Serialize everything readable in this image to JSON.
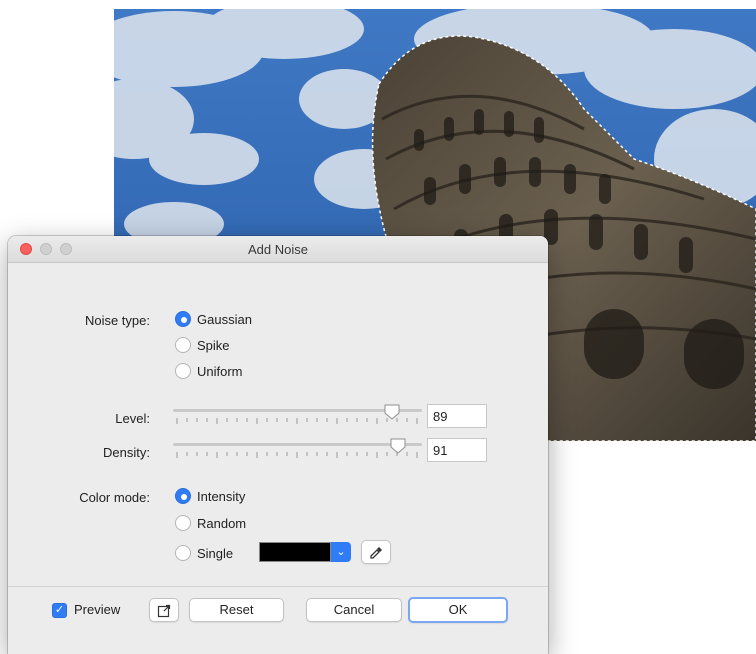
{
  "dialog": {
    "title": "Add Noise",
    "noise_type_label": "Noise type:",
    "noise_types": [
      "Gaussian",
      "Spike",
      "Uniform"
    ],
    "noise_type_selected": "Gaussian",
    "level_label": "Level:",
    "level_value": "89",
    "density_label": "Density:",
    "density_value": "91",
    "color_mode_label": "Color mode:",
    "color_modes": [
      "Intensity",
      "Random",
      "Single"
    ],
    "color_mode_selected": "Intensity",
    "single_color": "#000000",
    "preview_label": "Preview",
    "preview_checked": true,
    "reset_label": "Reset",
    "cancel_label": "Cancel",
    "ok_label": "OK"
  },
  "icons": {
    "eyedropper": "eyedropper-icon",
    "dropdown": "chevron-down-icon",
    "export": "export-icon",
    "check": "checkmark-icon"
  },
  "colors": {
    "accent": "#2f7cf6",
    "close_button": "#fc605c",
    "sky": "#2f66b2"
  }
}
